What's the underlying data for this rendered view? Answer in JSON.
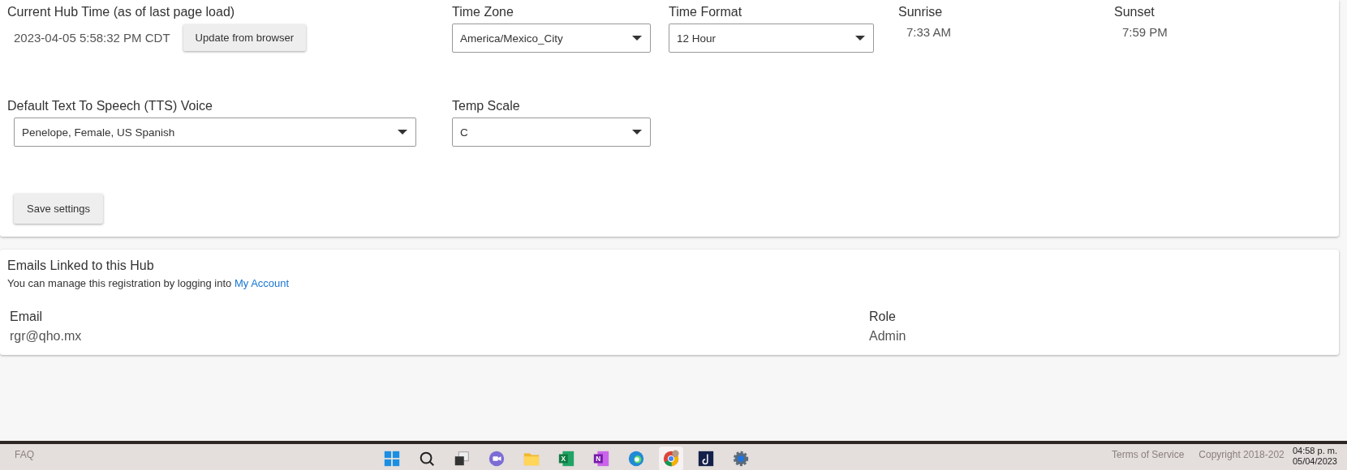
{
  "settings": {
    "hub_time": {
      "label": "Current Hub Time (as of last page load)",
      "value": "2023-04-05 5:58:32 PM CDT",
      "button": "Update from browser"
    },
    "time_zone": {
      "label": "Time Zone",
      "value": "America/Mexico_City"
    },
    "time_format": {
      "label": "Time Format",
      "value": "12 Hour"
    },
    "sunrise": {
      "label": "Sunrise",
      "value": "7:33 AM"
    },
    "sunset": {
      "label": "Sunset",
      "value": "7:59 PM"
    },
    "tts_voice": {
      "label": "Default Text To Speech (TTS) Voice",
      "value": "Penelope, Female, US Spanish"
    },
    "temp_scale": {
      "label": "Temp Scale",
      "value": "C"
    },
    "save_button": "Save settings"
  },
  "emails": {
    "title": "Emails Linked to this Hub",
    "note": "You can manage this registration by logging into ",
    "link": "My Account",
    "columns": [
      "Email",
      "Role"
    ],
    "rows": [
      [
        "rgr@qho.mx",
        "Admin"
      ]
    ]
  },
  "footer": {
    "left": "FAQ",
    "links": [
      "Terms of Service",
      "Copyright 2018-202"
    ]
  },
  "taskbar": {
    "apps": [
      {
        "kind": "start",
        "selected": false
      },
      {
        "kind": "search",
        "selected": false
      },
      {
        "kind": "taskview",
        "selected": false
      },
      {
        "kind": "chat",
        "selected": false
      },
      {
        "kind": "folder",
        "selected": false
      },
      {
        "kind": "excel",
        "glyph": "X",
        "selected": false
      },
      {
        "kind": "onenote",
        "glyph": "N",
        "selected": false
      },
      {
        "kind": "edge",
        "selected": false
      },
      {
        "kind": "chrome",
        "selected": true
      },
      {
        "kind": "dark",
        "selected": false
      },
      {
        "kind": "gear",
        "selected": false
      }
    ],
    "time": "04:58 p. m.",
    "date": "05/04/2023"
  }
}
